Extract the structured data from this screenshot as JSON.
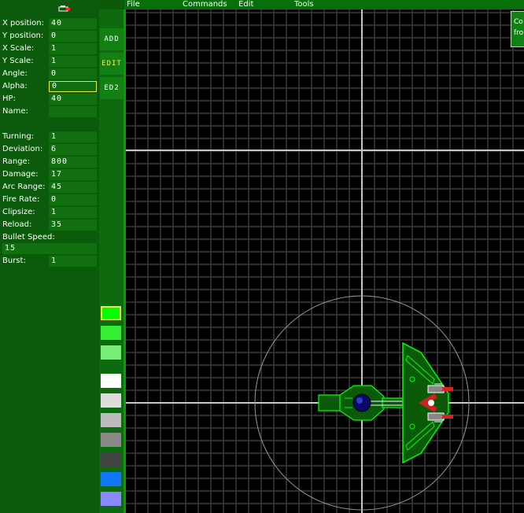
{
  "menu": {
    "file": "File",
    "commands": "Commands",
    "edit": "Edit",
    "tools": "Tools"
  },
  "properties": {
    "x_position": {
      "label": "X position:",
      "value": "40"
    },
    "y_position": {
      "label": "Y position:",
      "value": "0"
    },
    "x_scale": {
      "label": "X Scale:",
      "value": "1"
    },
    "y_scale": {
      "label": "Y Scale:",
      "value": "1"
    },
    "angle": {
      "label": "Angle:",
      "value": "0"
    },
    "alpha": {
      "label": "Alpha:",
      "value": "0"
    },
    "hp": {
      "label": "HP:",
      "value": "40"
    },
    "name": {
      "label": "Name:",
      "value": ""
    }
  },
  "weapon": {
    "turning": {
      "label": "Turning:",
      "value": "1"
    },
    "deviation": {
      "label": "Deviation:",
      "value": "6"
    },
    "range": {
      "label": "Range:",
      "value": "800"
    },
    "damage": {
      "label": "Damage:",
      "value": "17"
    },
    "arc_range": {
      "label": "Arc Range:",
      "value": "45"
    },
    "fire_rate": {
      "label": "Fire Rate:",
      "value": "0"
    },
    "clipsize": {
      "label": "Clipsize:",
      "value": "1"
    },
    "reload": {
      "label": "Reload:",
      "value": "35"
    },
    "bullet_speed": {
      "label": "Bullet Speed:",
      "value": "15"
    },
    "burst": {
      "label": "Burst:",
      "value": "1"
    }
  },
  "modes": {
    "add": "ADD",
    "edit": "EDIT",
    "ed2": "ED2",
    "active": "EDIT"
  },
  "palette": {
    "selected": "#00ff00",
    "colors": [
      "#00ff00",
      "#33ee33",
      "#77ee77",
      "#ffffff",
      "#dddddd",
      "#bbbbbb",
      "#888888",
      "#444444",
      "#1177ff",
      "#8888ff"
    ]
  },
  "tooltip": {
    "line1": "Co",
    "line2": "fro"
  },
  "colors": {
    "panel_bg": "#0c5a0c",
    "field_bg": "#107010",
    "grid_line": "#3a3a3a",
    "axis_line": "#c8c8c8",
    "part_outline": "#00ff00",
    "range_circle": "#888888",
    "highlight": "#e8e840"
  }
}
